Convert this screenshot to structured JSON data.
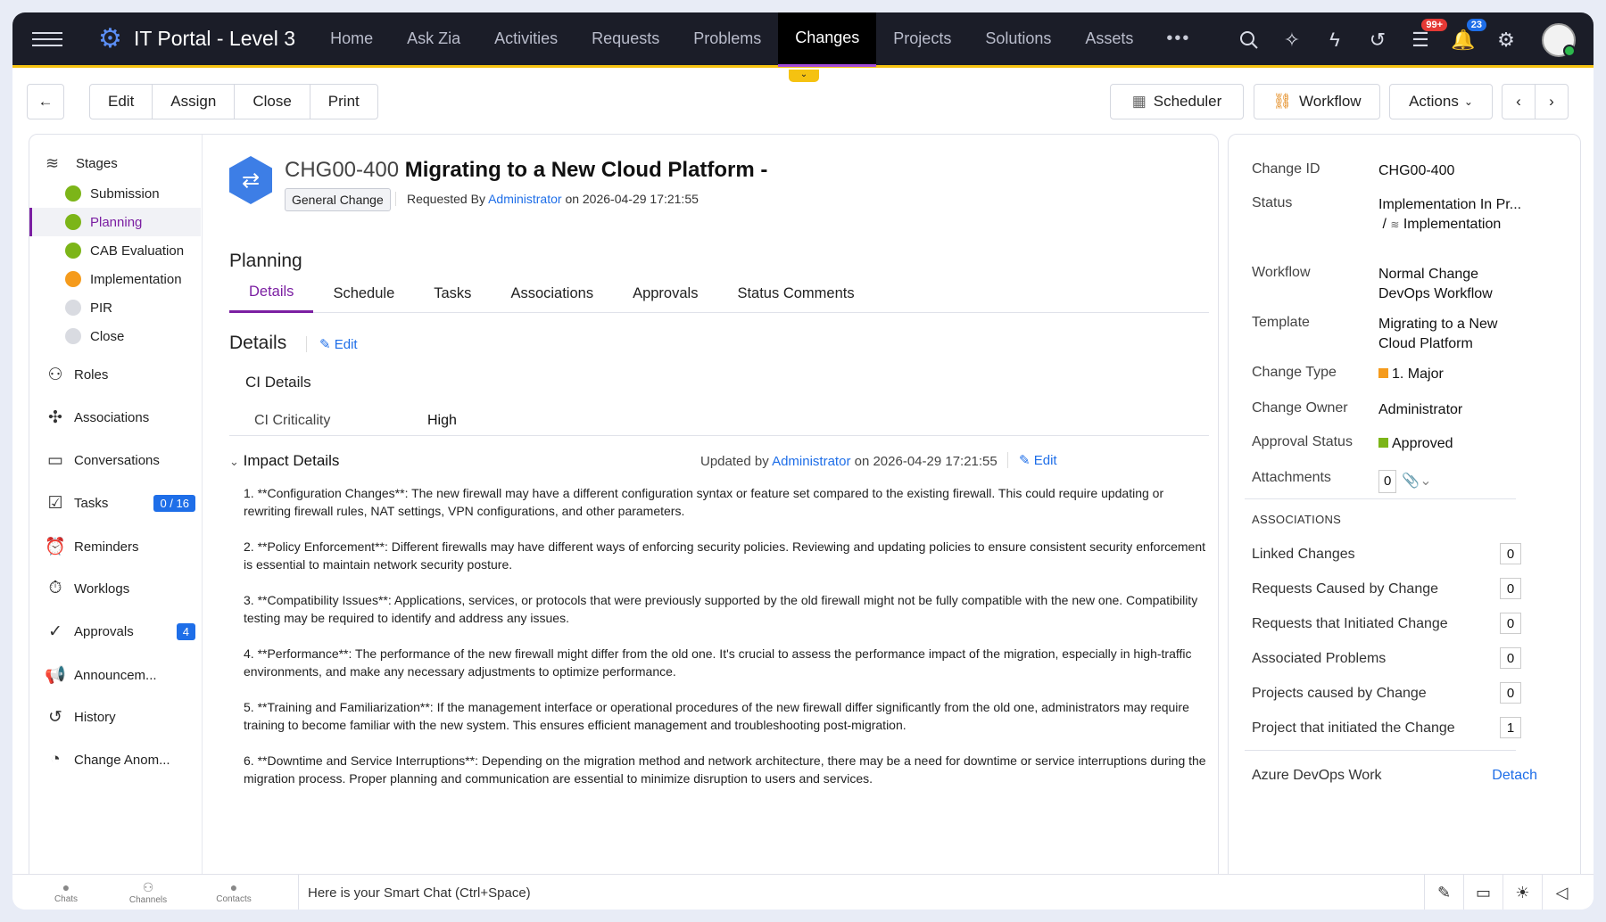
{
  "nav": {
    "app_title": "IT Portal - Level 3",
    "items": [
      "Home",
      "Ask Zia",
      "Activities",
      "Requests",
      "Problems",
      "Changes",
      "Projects",
      "Solutions",
      "Assets"
    ],
    "active": "Changes",
    "more": "•••",
    "badge_tasks": "99+",
    "badge_notifications": "23"
  },
  "toolbar": {
    "edit": "Edit",
    "assign": "Assign",
    "close": "Close",
    "print": "Print",
    "scheduler": "Scheduler",
    "workflow": "Workflow",
    "actions": "Actions"
  },
  "sidebar": {
    "stages_label": "Stages",
    "stages": [
      {
        "label": "Submission",
        "color": "#7cb518"
      },
      {
        "label": "Planning",
        "color": "#7cb518"
      },
      {
        "label": "CAB Evaluation",
        "color": "#7cb518"
      },
      {
        "label": "Implementation",
        "color": "#f59b1c"
      },
      {
        "label": "PIR",
        "color": "#d9dbe1"
      },
      {
        "label": "Close",
        "color": "#d9dbe1"
      }
    ],
    "items": {
      "roles": "Roles",
      "associations": "Associations",
      "conversations": "Conversations",
      "tasks": "Tasks",
      "tasks_count": "0 / 16",
      "reminders": "Reminders",
      "worklogs": "Worklogs",
      "approvals": "Approvals",
      "approvals_count": "4",
      "announcements": "Announcem...",
      "history": "History",
      "change_anom": "Change Anom..."
    }
  },
  "main": {
    "change_id": "CHG00-400",
    "change_title": "Migrating to a New Cloud Platform -",
    "chip": "General Change",
    "requested_by_label": "Requested By",
    "requested_by": "Administrator",
    "requested_on": "on 2026-04-29 17:21:55",
    "stage_label": "Planning",
    "tabs": [
      "Details",
      "Schedule",
      "Tasks",
      "Associations",
      "Approvals",
      "Status Comments"
    ],
    "details_title": "Details",
    "edit_label": "Edit",
    "ci_details_title": "CI Details",
    "ci_criticality_label": "CI Criticality",
    "ci_criticality_value": "High",
    "impact_title": "Impact Details",
    "impact_updated_label": "Updated by",
    "impact_updated_by": "Administrator",
    "impact_updated_on": "on 2026-04-29 17:21:55",
    "impact_items": [
      "1. **Configuration Changes**: The new firewall may have a different configuration syntax or feature set compared to the existing firewall. This could require updating or rewriting firewall rules, NAT settings, VPN configurations, and other parameters.",
      "2. **Policy Enforcement**: Different firewalls may have different ways of enforcing security policies. Reviewing and updating policies to ensure consistent security enforcement is essential to maintain network security posture.",
      "3. **Compatibility Issues**: Applications, services, or protocols that were previously supported by the old firewall might not be fully compatible with the new one. Compatibility testing may be required to identify and address any issues.",
      "4. **Performance**: The performance of the new firewall might differ from the old one. It's crucial to assess the performance impact of the migration, especially in high-traffic environments, and make any necessary adjustments to optimize performance.",
      "5. **Training and Familiarization**: If the management interface or operational procedures of the new firewall differ significantly from the old one, administrators may require training to become familiar with the new system. This ensures efficient management and troubleshooting post-migration.",
      "6. **Downtime and Service Interruptions**: Depending on the migration method and network architecture, there may be a need for downtime or service interruptions during the migration process. Proper planning and communication are essential to minimize disruption to users and services."
    ]
  },
  "right": {
    "change_id_label": "Change ID",
    "change_id": "CHG00-400",
    "status_label": "Status",
    "status": "Implementation In Pr...",
    "status_stage": "Implementation",
    "workflow_label": "Workflow",
    "workflow": "Normal Change DevOps Workflow",
    "template_label": "Template",
    "template": "Migrating to a New Cloud Platform",
    "change_type_label": "Change Type",
    "change_type": "1. Major",
    "change_type_color": "#f59b1c",
    "owner_label": "Change Owner",
    "owner": "Administrator",
    "approval_label": "Approval Status",
    "approval": "Approved",
    "approval_color": "#7cb518",
    "attachments_label": "Attachments",
    "attachments_count": "0",
    "associations_title": "ASSOCIATIONS",
    "assoc": [
      {
        "label": "Linked Changes",
        "count": "0"
      },
      {
        "label": "Requests Caused by Change",
        "count": "0"
      },
      {
        "label": "Requests that Initiated Change",
        "count": "0"
      },
      {
        "label": "Associated Problems",
        "count": "0"
      },
      {
        "label": "Projects caused by Change",
        "count": "0"
      },
      {
        "label": "Project that initiated the Change",
        "count": "1"
      }
    ],
    "azure_label": "Azure DevOps Work",
    "azure_action": "Detach"
  },
  "bottom": {
    "chats": "Chats",
    "channels": "Channels",
    "contacts": "Contacts",
    "smart_chat": "Here is your Smart Chat (Ctrl+Space)"
  }
}
